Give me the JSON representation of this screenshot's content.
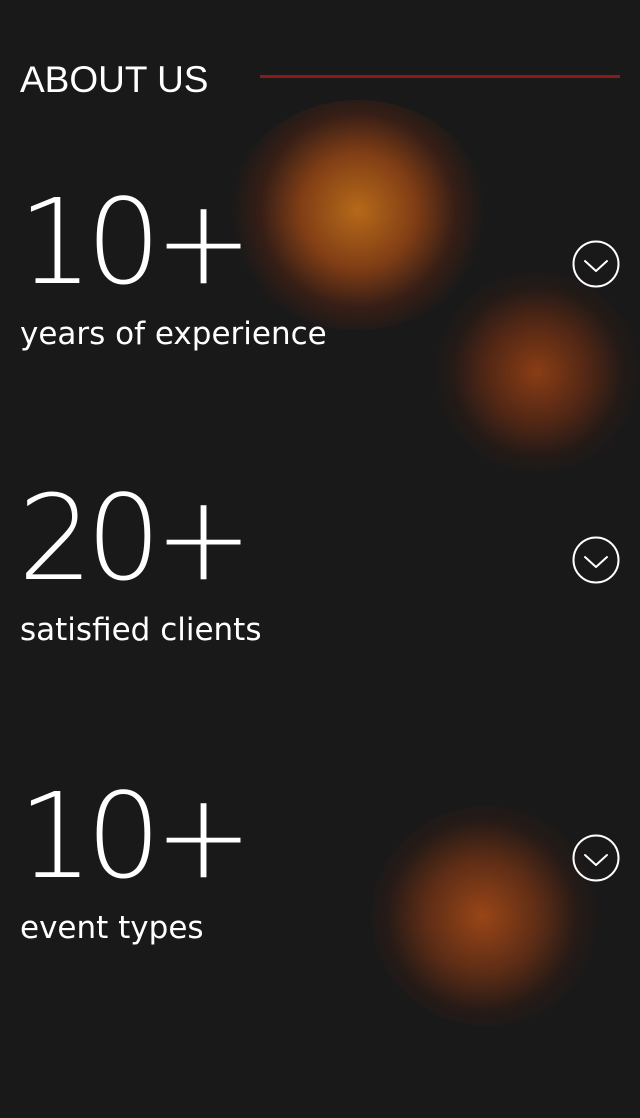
{
  "header": {
    "title": "ABOUT US",
    "accent_color": "#8c1a1a"
  },
  "stats": [
    {
      "value": "10+",
      "label": "years of experience",
      "icon": "chevron-down-icon"
    },
    {
      "value": "20+",
      "label": "satisfied clients",
      "icon": "chevron-down-icon"
    },
    {
      "value": "10+",
      "label": "event types",
      "icon": "chevron-down-icon"
    }
  ],
  "colors": {
    "background": "#191919",
    "text": "#ffffff",
    "glow": "#b4651c"
  }
}
